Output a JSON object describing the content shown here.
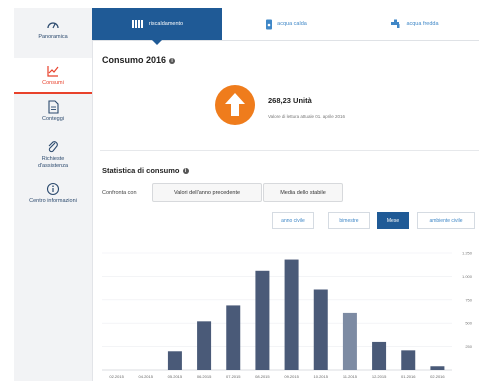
{
  "sidebar": {
    "items": [
      {
        "label": "Panoramica",
        "icon": "gauge-icon"
      },
      {
        "label": "Consumi",
        "icon": "chart-line-icon",
        "active": true
      },
      {
        "label": "Conteggi",
        "icon": "document-icon"
      },
      {
        "label": "Richieste d'assistenza",
        "icon": "paperclip-icon"
      },
      {
        "label": "Centro informazioni",
        "icon": "info-icon"
      }
    ]
  },
  "tabs": [
    {
      "label": "riscaldamento",
      "icon": "radiator-icon",
      "active": true
    },
    {
      "label": "acqua calda",
      "icon": "water-heater-icon"
    },
    {
      "label": "acqua fredda",
      "icon": "faucet-icon"
    }
  ],
  "consumo": {
    "title": "Consumo 2016",
    "value": "268,23 Unità",
    "note": "Valore di lettura attuale 01. aprile 2016",
    "arrow_icon": "arrow-up-icon",
    "accent_color": "#ef7c1c"
  },
  "statistica": {
    "title": "Statistica di consumo",
    "confronta_label": "Confronta con",
    "compare_buttons": [
      "Valori dell'anno precedente",
      "Media dello stabile"
    ],
    "period_buttons": [
      {
        "label": "anno civile"
      },
      {
        "label": "bimestre"
      },
      {
        "label": "Mese",
        "active": true
      },
      {
        "label": "ambiente civile"
      }
    ]
  },
  "chart_data": {
    "type": "bar",
    "categories": [
      "02.2015",
      "04.2015",
      "05.2015",
      "06.2015",
      "07.2015",
      "08.2015",
      "09.2015",
      "10.2015",
      "11.2015",
      "12.2015",
      "01.2016",
      "02.2016"
    ],
    "values": [
      0,
      0,
      200,
      520,
      690,
      1060,
      1180,
      860,
      610,
      300,
      210,
      40
    ],
    "ylim": [
      0,
      1250
    ],
    "yticks": [
      "250",
      "500",
      "750",
      "1.000",
      "1.250"
    ],
    "bar_color": "#4a5a78",
    "highlight_color": "#7d8ba3",
    "highlight_index": 8,
    "grid": true
  }
}
